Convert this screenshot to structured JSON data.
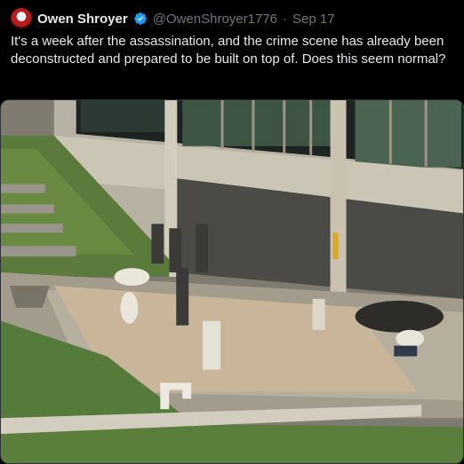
{
  "tweet": {
    "author_name": "Owen Shroyer",
    "handle": "@OwenShroyer1776",
    "separator": "·",
    "date": "Sep 17",
    "text": "It's a week after the assassination, and the crime scene has already been deconstructed and prepared to be built on top of. Does this seem normal?",
    "verified_color": "#1d9bf0",
    "icons": {
      "avatar": "profile-avatar",
      "verified": "verified-badge-icon"
    }
  }
}
